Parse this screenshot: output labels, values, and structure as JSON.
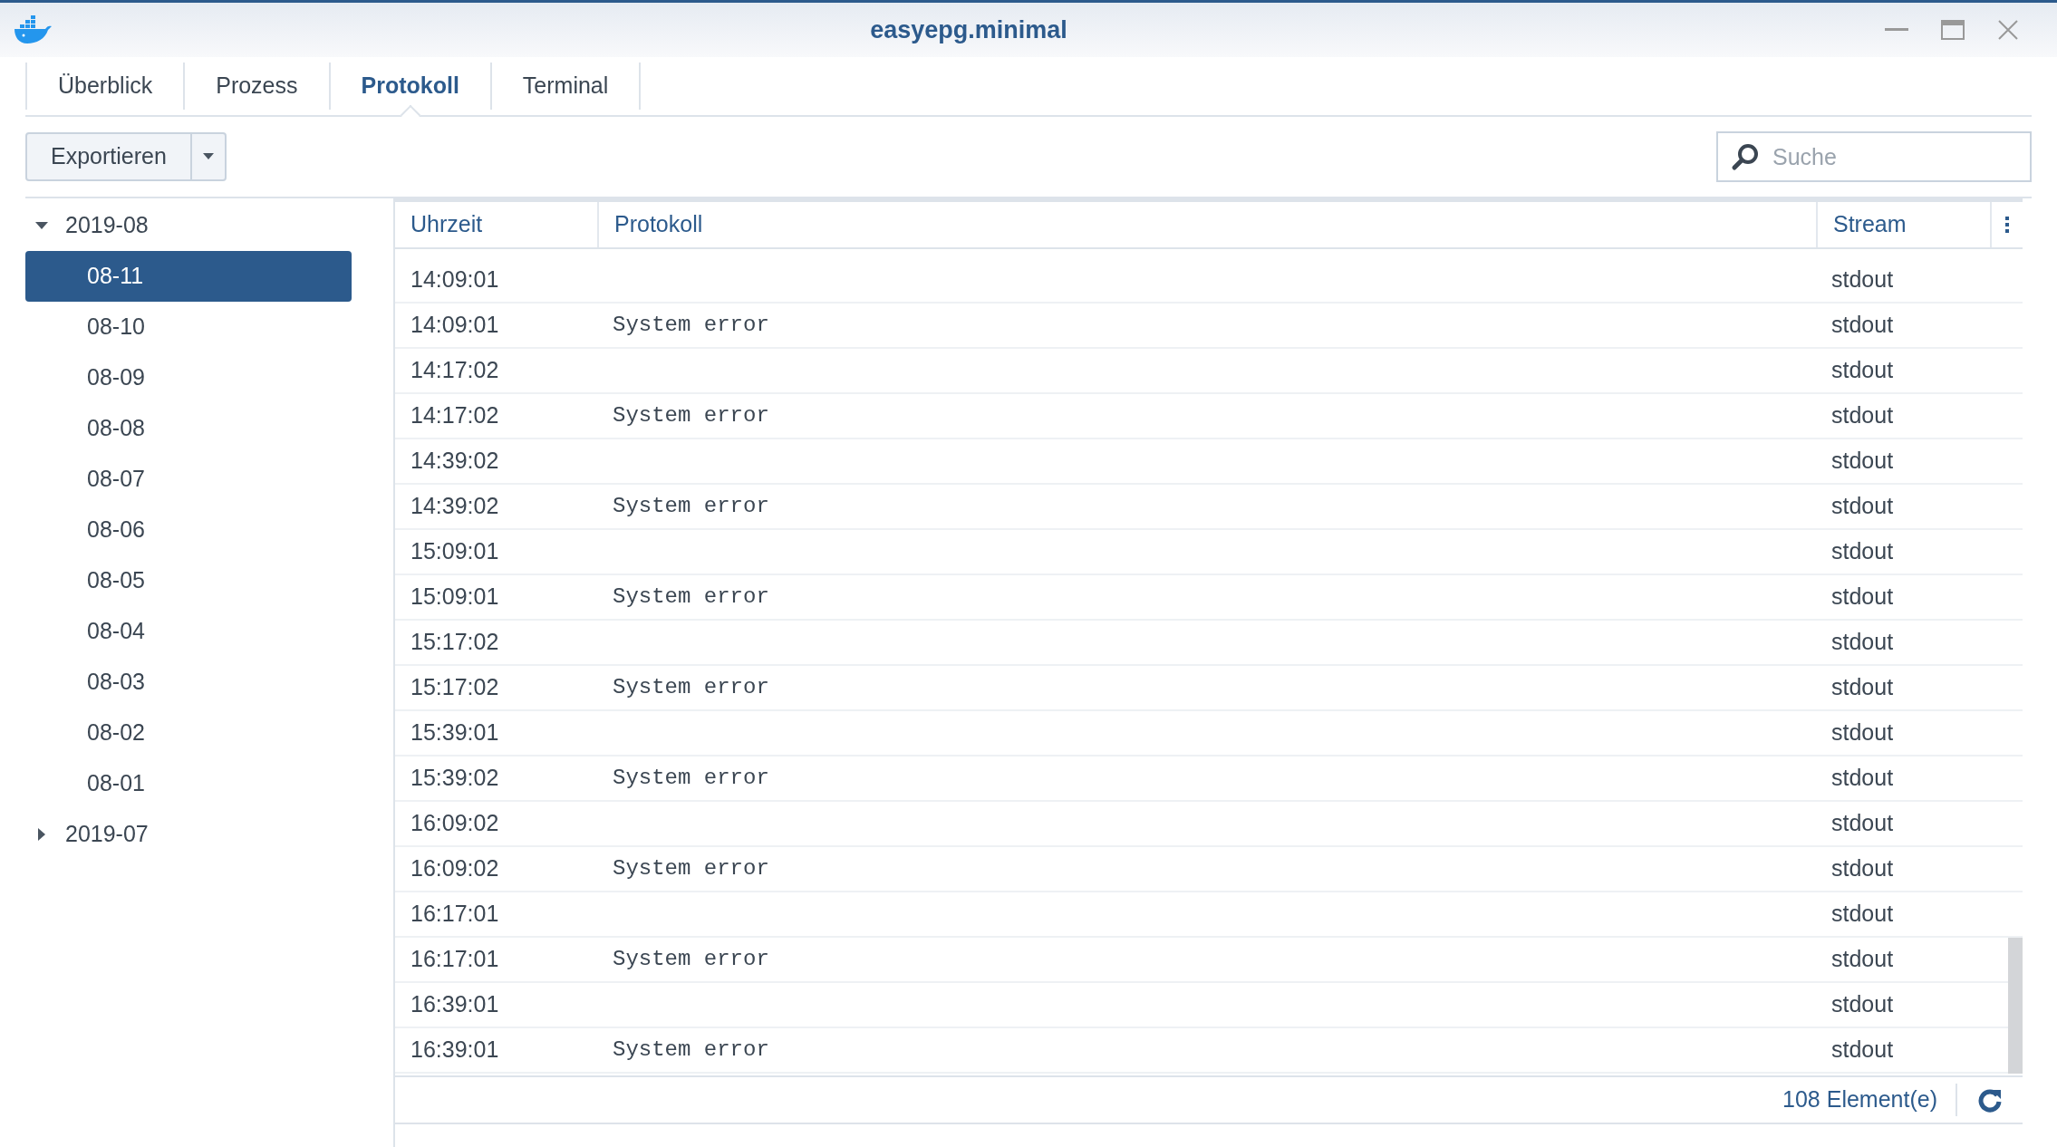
{
  "window": {
    "title": "easyepg.minimal"
  },
  "tabs": [
    {
      "label": "Überblick",
      "selected": false
    },
    {
      "label": "Prozess",
      "selected": false
    },
    {
      "label": "Protokoll",
      "selected": true
    },
    {
      "label": "Terminal",
      "selected": false
    }
  ],
  "toolbar": {
    "export_button": "Exportieren",
    "search": {
      "placeholder": "Suche"
    }
  },
  "sidebar": {
    "items": [
      {
        "label": "2019-08",
        "expanded": true,
        "selected": false,
        "children": [
          {
            "label": "08-11",
            "selected": true
          },
          {
            "label": "08-10",
            "selected": false
          },
          {
            "label": "08-09",
            "selected": false
          },
          {
            "label": "08-08",
            "selected": false
          },
          {
            "label": "08-07",
            "selected": false
          },
          {
            "label": "08-06",
            "selected": false
          },
          {
            "label": "08-05",
            "selected": false
          },
          {
            "label": "08-04",
            "selected": false
          },
          {
            "label": "08-03",
            "selected": false
          },
          {
            "label": "08-02",
            "selected": false
          },
          {
            "label": "08-01",
            "selected": false
          }
        ]
      },
      {
        "label": "2019-07",
        "expanded": false,
        "selected": false
      }
    ]
  },
  "table": {
    "columns": [
      "Uhrzeit",
      "Protokoll",
      "Stream"
    ],
    "rows": [
      {
        "time": "14:09:01",
        "stream": "stdout"
      },
      {
        "time": "14:09:01",
        "message": "System error",
        "stream": "stdout"
      },
      {
        "time": "14:17:02",
        "stream": "stdout"
      },
      {
        "time": "14:17:02",
        "message": "System error",
        "stream": "stdout"
      },
      {
        "time": "14:39:02",
        "stream": "stdout"
      },
      {
        "time": "14:39:02",
        "message": "System error",
        "stream": "stdout"
      },
      {
        "time": "15:09:01",
        "stream": "stdout"
      },
      {
        "time": "15:09:01",
        "message": "System error",
        "stream": "stdout"
      },
      {
        "time": "15:17:02",
        "stream": "stdout"
      },
      {
        "time": "15:17:02",
        "message": "System error",
        "stream": "stdout"
      },
      {
        "time": "15:39:01",
        "stream": "stdout"
      },
      {
        "time": "15:39:02",
        "message": "System error",
        "stream": "stdout"
      },
      {
        "time": "16:09:02",
        "stream": "stdout"
      },
      {
        "time": "16:09:02",
        "message": "System error",
        "stream": "stdout"
      },
      {
        "time": "16:17:01",
        "stream": "stdout"
      },
      {
        "time": "16:17:01",
        "message": "System error",
        "stream": "stdout"
      },
      {
        "time": "16:39:01",
        "stream": "stdout"
      },
      {
        "time": "16:39:01",
        "message": "System error",
        "stream": "stdout"
      }
    ]
  },
  "status_bar": {
    "count": "108 Element(e)"
  }
}
